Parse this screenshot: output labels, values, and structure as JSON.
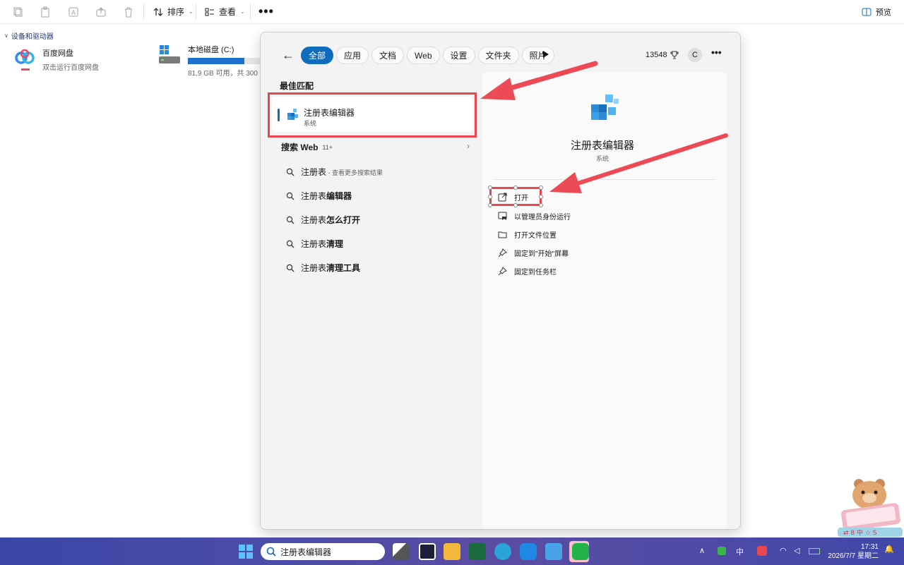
{
  "toolbar": {
    "sort_label": "排序",
    "view_label": "查看",
    "more": "•••",
    "preview_label": "预览"
  },
  "explorer": {
    "group": "设备和驱动器",
    "drives": [
      {
        "name": "百度网盘",
        "sub": "双击运行百度网盘"
      },
      {
        "name": "本地磁盘 (C:)",
        "sub": "81.9 GB 可用，共 300",
        "usage": 0.73
      }
    ]
  },
  "search": {
    "tabs": [
      "全部",
      "应用",
      "文档",
      "Web",
      "设置",
      "文件夹",
      "照片"
    ],
    "active_tab": "全部",
    "points": "13548",
    "avatar": "C",
    "more": "•••",
    "best_match_title": "最佳匹配",
    "best_match": {
      "name": "注册表编辑器",
      "type": "系统"
    },
    "web_title": "搜索 Web",
    "web_count": "11+",
    "suggestions": [
      {
        "base": "注册表",
        "bold": "",
        "hint": " - 查看更多搜索结果"
      },
      {
        "base": "注册表",
        "bold": "编辑器",
        "hint": ""
      },
      {
        "base": "注册表",
        "bold": "怎么打开",
        "hint": ""
      },
      {
        "base": "注册表",
        "bold": "清理",
        "hint": ""
      },
      {
        "base": "注册表",
        "bold": "清理工具",
        "hint": ""
      }
    ],
    "detail": {
      "title": "注册表编辑器",
      "subtitle": "系统",
      "actions": [
        "打开",
        "以管理员身份运行",
        "打开文件位置",
        "固定到\"开始\"屏幕",
        "固定到任务栏"
      ]
    }
  },
  "taskbar": {
    "search_text": "注册表编辑器",
    "ime": "中",
    "time": "17:31",
    "date": "2026/7/7 星期二"
  },
  "colors": {
    "accent": "#0f6cbd",
    "highlight": "#e8474f",
    "taskbar": "#4b4ca8"
  }
}
